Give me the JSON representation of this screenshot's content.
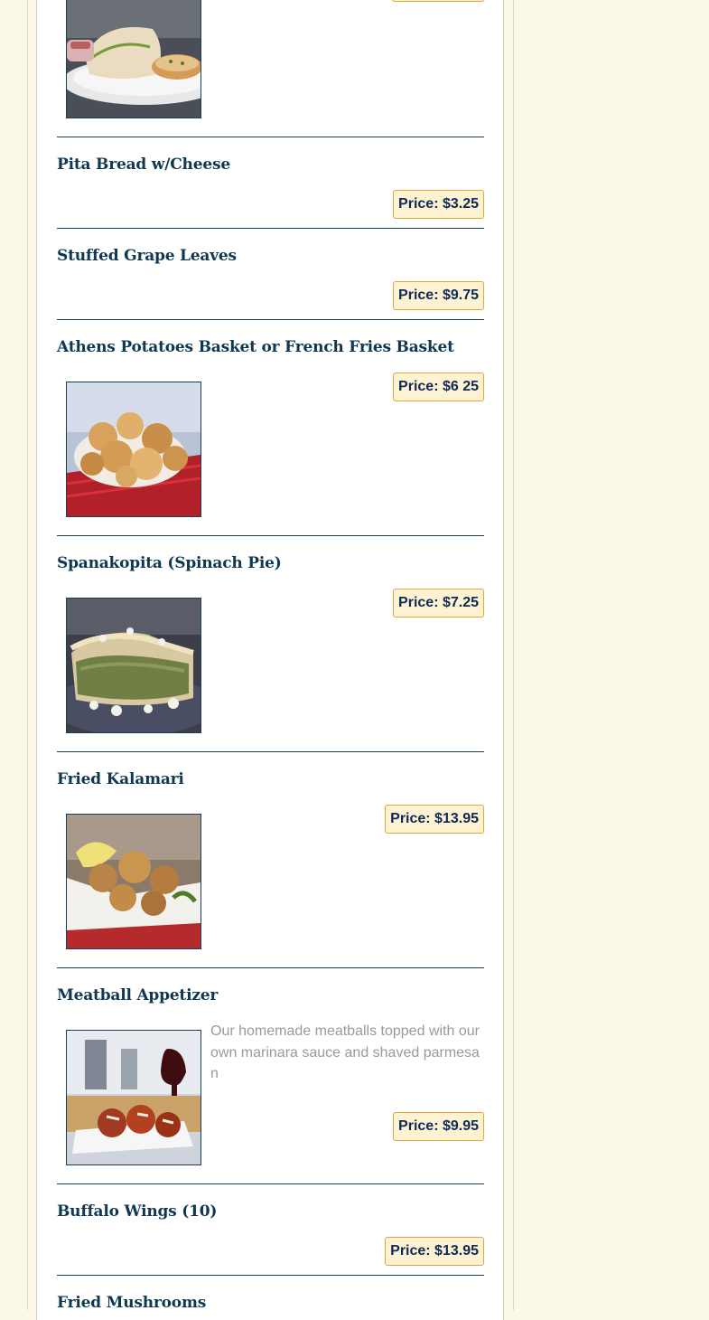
{
  "menu": {
    "items": [
      {
        "title": "",
        "price": "",
        "has_image": true,
        "image": "garlic-pita-plate"
      },
      {
        "title": "Pita Bread w/Cheese",
        "price": "Price: $3.25"
      },
      {
        "title": "Stuffed Grape Leaves",
        "price": "Price: $9.75"
      },
      {
        "title": "Athens Potatoes Basket or French Fries Basket",
        "price": "Price: $6 25",
        "image": "potatoes-basket"
      },
      {
        "title": "Spanakopita (Spinach Pie)",
        "price": "Price: $7.25",
        "image": "spanakopita"
      },
      {
        "title": "Fried Kalamari",
        "price": "Price: $13.95",
        "image": "fried-kalamari"
      },
      {
        "title": "Meatball Appetizer",
        "description": "Our homemade meatballs topped with our own marinara sauce and shaved parmesan",
        "price": "Price: $9.95",
        "image": "meatballs"
      },
      {
        "title": "Buffalo Wings (10)",
        "price": "Price: $13.95"
      },
      {
        "title": "Fried Mushrooms"
      }
    ]
  },
  "colors": {
    "page_bg": "#fcf8e6",
    "title": "#0f3850",
    "price_bg": "#fdf2d2",
    "price_border": "#e0a636",
    "divider": "#1d3f55"
  }
}
